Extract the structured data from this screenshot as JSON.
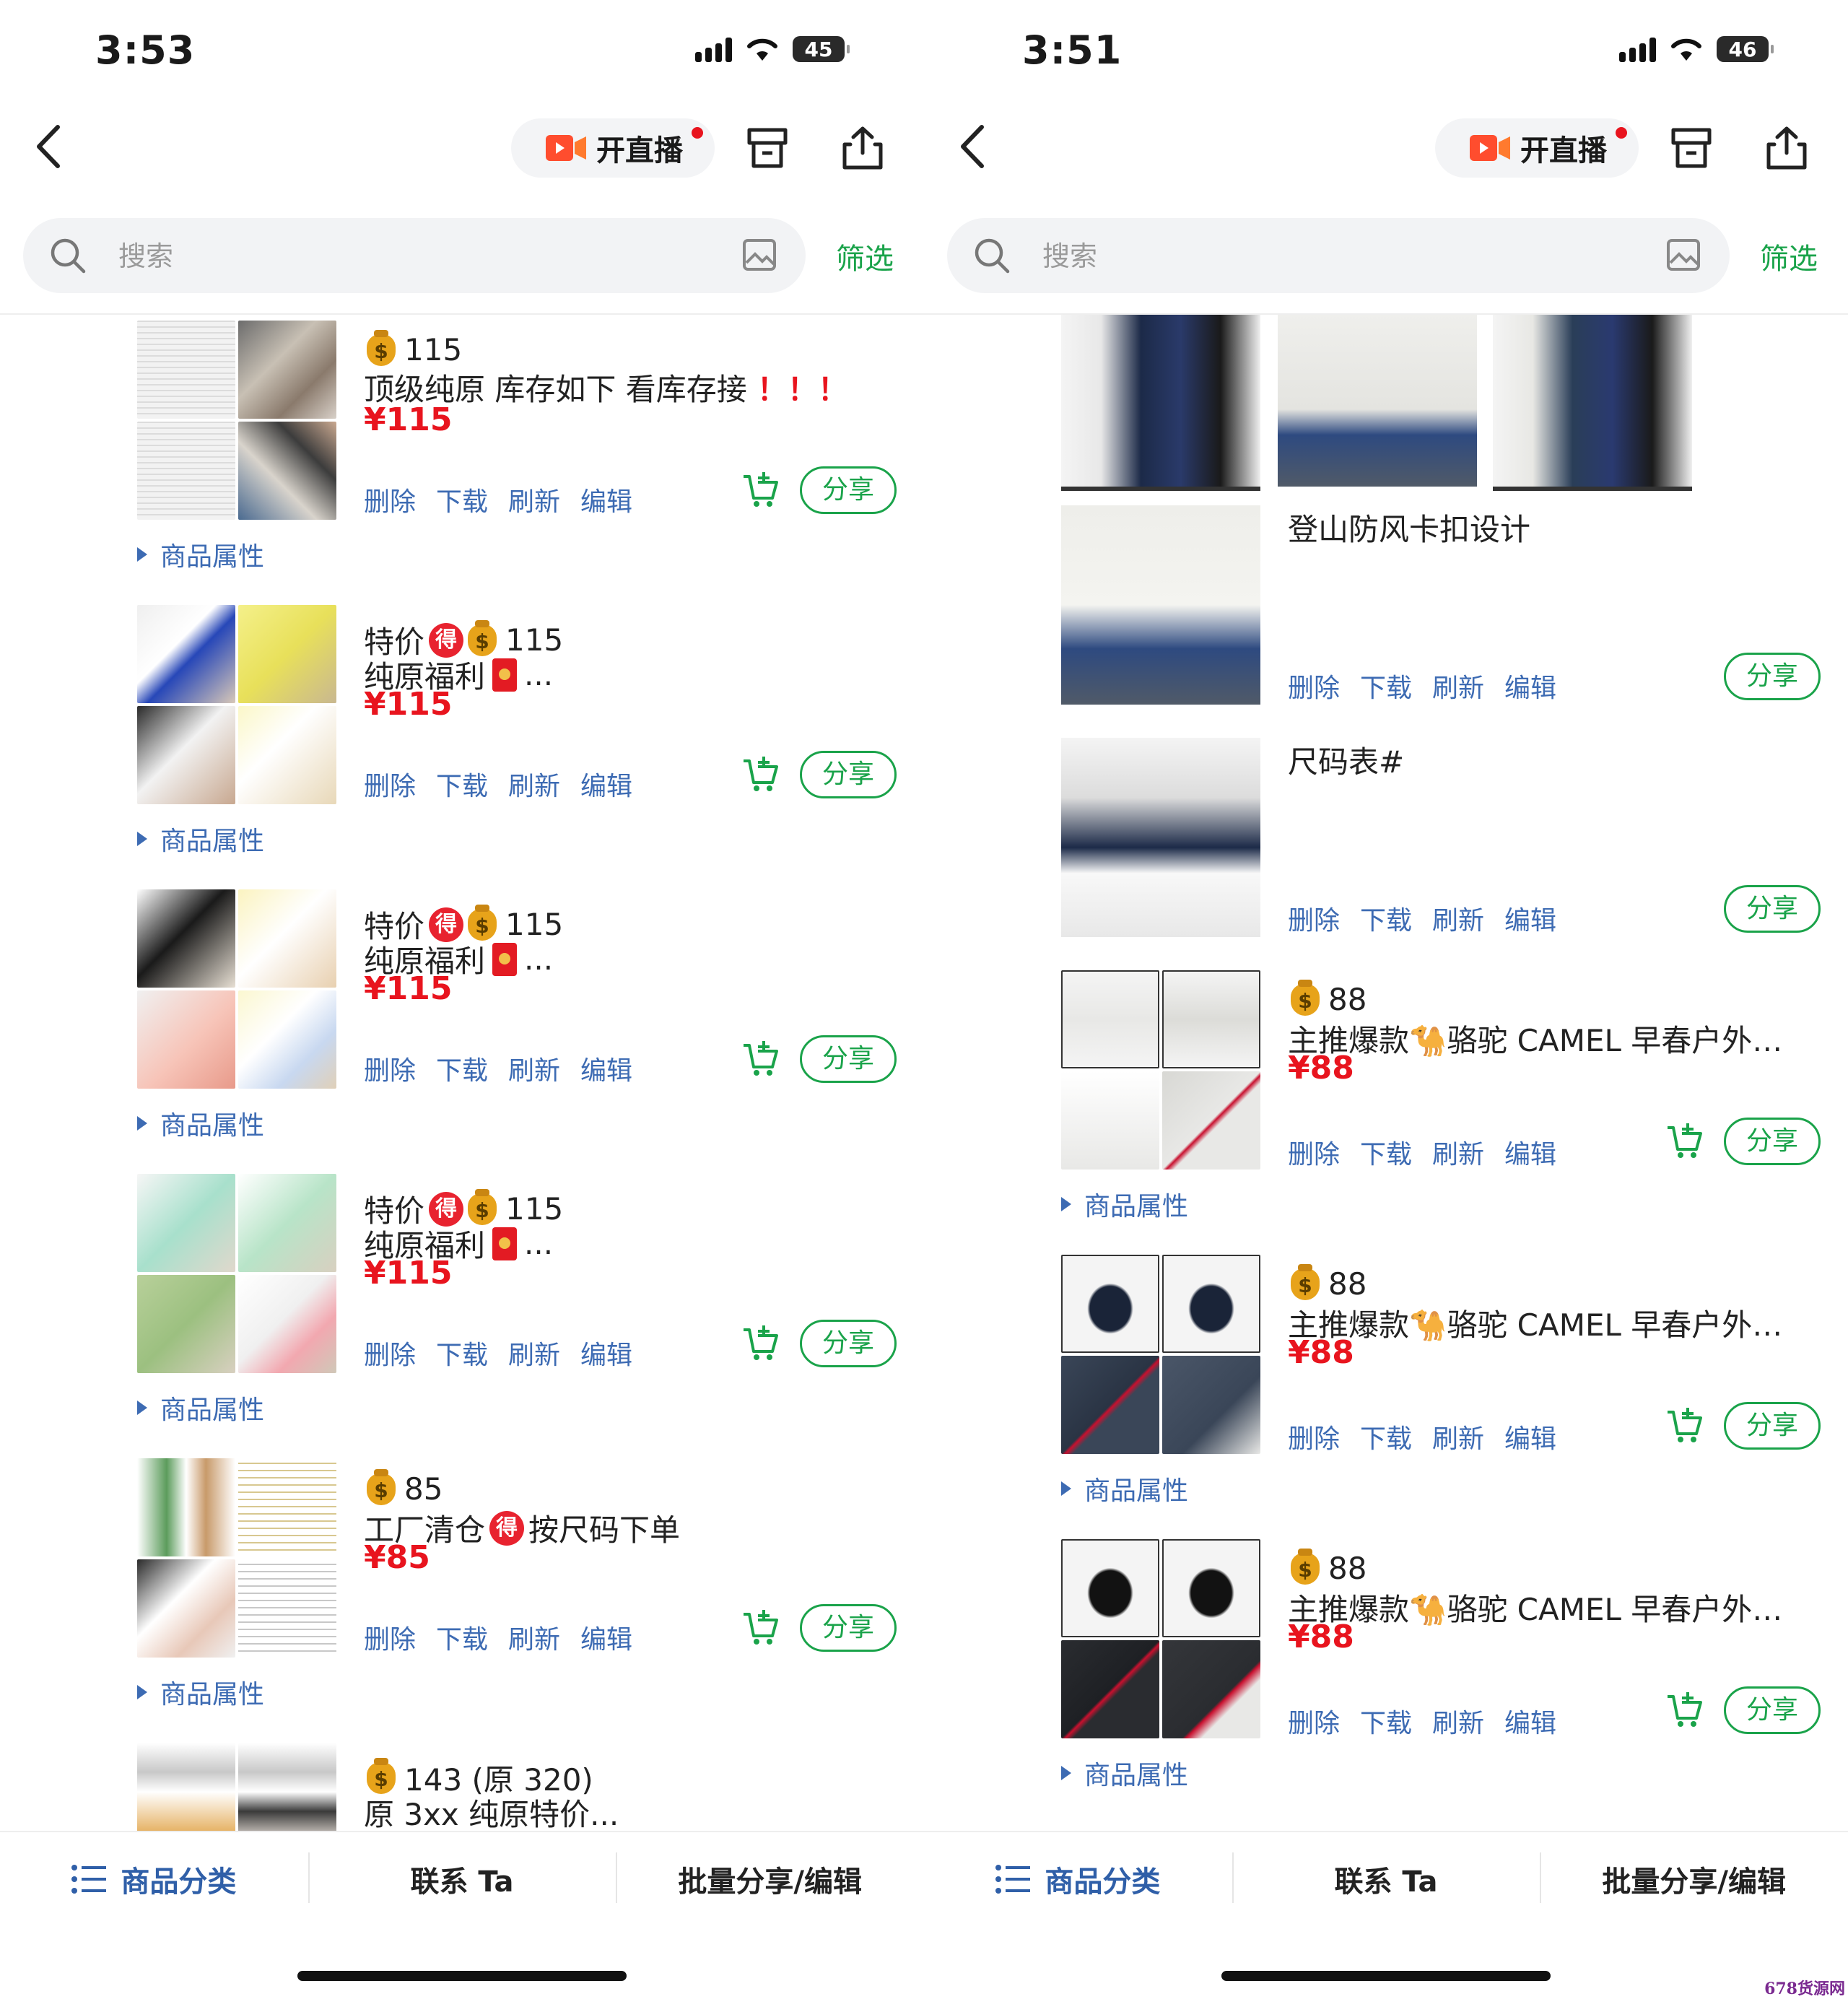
{
  "left": {
    "status": {
      "time": "3:53",
      "battery": "45"
    },
    "nav": {
      "live_label": "开直播"
    },
    "search": {
      "placeholder": "搜索",
      "filter_label": "筛选"
    },
    "items": [
      {
        "price_tag": "115",
        "title": "顶级纯原 库存如下 看库存接",
        "title_suffix": "！！！",
        "price": "¥115",
        "actions": [
          "删除",
          "下载",
          "刷新",
          "编辑"
        ],
        "share": "分享",
        "attr": "商品属性"
      },
      {
        "prefix": "特价",
        "price_tag": "115",
        "title": "纯原福利",
        "ellipsis": "...",
        "price": "¥115",
        "actions": [
          "删除",
          "下载",
          "刷新",
          "编辑"
        ],
        "share": "分享",
        "attr": "商品属性"
      },
      {
        "prefix": "特价",
        "price_tag": "115",
        "title": "纯原福利",
        "ellipsis": "...",
        "price": "¥115",
        "actions": [
          "删除",
          "下载",
          "刷新",
          "编辑"
        ],
        "share": "分享",
        "attr": "商品属性"
      },
      {
        "prefix": "特价",
        "price_tag": "115",
        "title": "纯原福利",
        "ellipsis": "...",
        "price": "¥115",
        "actions": [
          "删除",
          "下载",
          "刷新",
          "编辑"
        ],
        "share": "分享",
        "attr": "商品属性"
      },
      {
        "price_tag": "85",
        "title_a": "工厂清仓",
        "title_b": "按尺码下单",
        "price": "¥85",
        "actions": [
          "删除",
          "下载",
          "刷新",
          "编辑"
        ],
        "share": "分享",
        "attr": "商品属性"
      },
      {
        "price_tag": "143 (原 320)",
        "title": "原 3xx 纯原特价..."
      }
    ],
    "de_badge": "得",
    "tabs": [
      "商品分类",
      "联系 Ta",
      "批量分享/编辑"
    ]
  },
  "right": {
    "status": {
      "time": "3:51",
      "battery": "46"
    },
    "nav": {
      "live_label": "开直播"
    },
    "search": {
      "placeholder": "搜索",
      "filter_label": "筛选"
    },
    "items": [
      {
        "title": "登山防风卡扣设计",
        "actions": [
          "删除",
          "下载",
          "刷新",
          "编辑"
        ],
        "share": "分享"
      },
      {
        "title": "尺码表#",
        "actions": [
          "删除",
          "下载",
          "刷新",
          "编辑"
        ],
        "share": "分享"
      },
      {
        "price_tag": "88",
        "title_a": "主推爆款",
        "title_b": "骆驼 CAMEL 早春户外防...",
        "price": "¥88",
        "actions": [
          "删除",
          "下载",
          "刷新",
          "编辑"
        ],
        "share": "分享",
        "attr": "商品属性"
      },
      {
        "price_tag": "88",
        "title_a": "主推爆款",
        "title_b": "骆驼 CAMEL 早春户外防...",
        "price": "¥88",
        "actions": [
          "删除",
          "下载",
          "刷新",
          "编辑"
        ],
        "share": "分享",
        "attr": "商品属性"
      },
      {
        "price_tag": "88",
        "title_a": "主推爆款",
        "title_b": "骆驼 CAMEL 早春户外防...",
        "price": "¥88",
        "actions": [
          "删除",
          "下载",
          "刷新",
          "编辑"
        ],
        "share": "分享",
        "attr": "商品属性"
      }
    ],
    "camel_emoji": "🐪",
    "tabs": [
      "商品分类",
      "联系 Ta",
      "批量分享/编辑"
    ]
  },
  "colors": {
    "accent_green": "#1aa34a",
    "link_blue": "#3d6bb3",
    "price_red": "#e8141e",
    "category_blue": "#2f5fa8"
  },
  "icons": [
    "back-icon",
    "live-camera-icon",
    "store-icon",
    "share-out-icon",
    "search-icon",
    "image-search-icon",
    "cart-add-icon",
    "coin-bag-icon",
    "menu-list-icon"
  ],
  "watermark": "678货源网"
}
